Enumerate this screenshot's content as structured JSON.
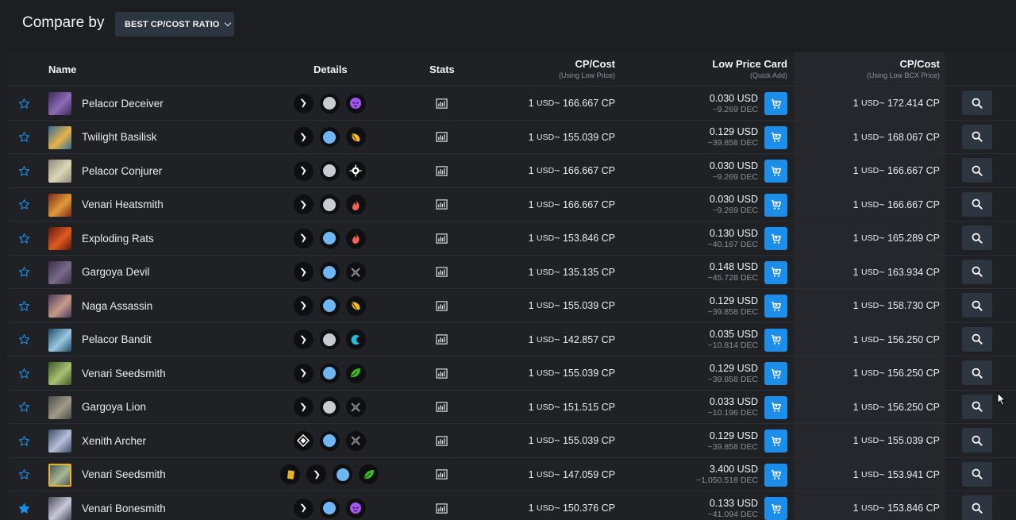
{
  "toolbar": {
    "compare_label": "Compare by",
    "compare_value": "BEST CP/COST RATIO"
  },
  "columns": {
    "name": "Name",
    "details": "Details",
    "stats": "Stats",
    "cp_cost": "CP/Cost",
    "cp_cost_sub": "(Using Low Price)",
    "low_price": "Low Price Card",
    "low_price_sub": "(Quick Add)",
    "cp_cost_bcx": "CP/Cost",
    "cp_cost_bcx_sub": "(Using Low BCX Price)"
  },
  "icons": {
    "favorite": "star-icon",
    "stats": "stats-chart-icon",
    "cart": "cart-icon",
    "inspect": "magnifier-icon"
  },
  "colors": {
    "accent_blue": "#1c8eea",
    "edition_grey": "#c7ccd2",
    "edition_blue": "#6fb6f5",
    "death": "#a855f7",
    "earth": "#3dbb25",
    "fire": "#f0634e",
    "water": "#1fc0df",
    "life": "#f5c013",
    "gold_foil": "#e6b422"
  },
  "rows": [
    {
      "name": "Pelacor Deceiver",
      "thumb": [
        "#3a2a55",
        "#8d6bb8"
      ],
      "fav": false,
      "gold": false,
      "details": [
        "type-monster",
        "edition-grey",
        "death"
      ],
      "cp_ratio": "1 USD ~ 166.667 CP",
      "usd": "0.030 USD",
      "dec": "~9.269 DEC",
      "bcx_ratio": "1 USD ~ 172.414 CP"
    },
    {
      "name": "Twilight Basilisk",
      "thumb": [
        "#2f6c9a",
        "#e8b34a"
      ],
      "fav": false,
      "gold": false,
      "details": [
        "type-monster",
        "edition-blue",
        "life"
      ],
      "cp_ratio": "1 USD ~ 155.039 CP",
      "usd": "0.129 USD",
      "dec": "~39.858 DEC",
      "bcx_ratio": "1 USD ~ 168.067 CP"
    },
    {
      "name": "Pelacor Conjurer",
      "thumb": [
        "#8d8a7a",
        "#ddd6b8"
      ],
      "fav": false,
      "gold": false,
      "details": [
        "type-monster",
        "edition-grey",
        "neutral"
      ],
      "cp_ratio": "1 USD ~ 166.667 CP",
      "usd": "0.030 USD",
      "dec": "~9.269 DEC",
      "bcx_ratio": "1 USD ~ 166.667 CP"
    },
    {
      "name": "Venari Heatsmith",
      "thumb": [
        "#7a2a1a",
        "#e09a3a"
      ],
      "fav": false,
      "gold": false,
      "details": [
        "type-monster",
        "edition-grey",
        "fire"
      ],
      "cp_ratio": "1 USD ~ 166.667 CP",
      "usd": "0.030 USD",
      "dec": "~9.269 DEC",
      "bcx_ratio": "1 USD ~ 166.667 CP"
    },
    {
      "name": "Exploding Rats",
      "thumb": [
        "#5a1a10",
        "#e05a20"
      ],
      "fav": false,
      "gold": false,
      "details": [
        "type-monster",
        "edition-blue",
        "fire"
      ],
      "cp_ratio": "1 USD ~ 153.846 CP",
      "usd": "0.130 USD",
      "dec": "~40.167 DEC",
      "bcx_ratio": "1 USD ~ 165.289 CP"
    },
    {
      "name": "Gargoya Devil",
      "thumb": [
        "#3a3045",
        "#7a6a8a"
      ],
      "fav": false,
      "gold": false,
      "details": [
        "type-monster",
        "edition-blue",
        "dragon"
      ],
      "cp_ratio": "1 USD ~ 135.135 CP",
      "usd": "0.148 USD",
      "dec": "~45.728 DEC",
      "bcx_ratio": "1 USD ~ 163.934 CP"
    },
    {
      "name": "Naga Assassin",
      "thumb": [
        "#4a3a5a",
        "#c89a8a"
      ],
      "fav": false,
      "gold": false,
      "details": [
        "type-monster",
        "edition-blue",
        "life"
      ],
      "cp_ratio": "1 USD ~ 155.039 CP",
      "usd": "0.129 USD",
      "dec": "~39.858 DEC",
      "bcx_ratio": "1 USD ~ 158.730 CP"
    },
    {
      "name": "Pelacor Bandit",
      "thumb": [
        "#1f4a6a",
        "#9ac8e0"
      ],
      "fav": false,
      "gold": false,
      "details": [
        "type-monster",
        "edition-grey",
        "water"
      ],
      "cp_ratio": "1 USD ~ 142.857 CP",
      "usd": "0.035 USD",
      "dec": "~10.814 DEC",
      "bcx_ratio": "1 USD ~ 156.250 CP"
    },
    {
      "name": "Venari Seedsmith",
      "thumb": [
        "#3a5a2a",
        "#a8c070"
      ],
      "fav": false,
      "gold": false,
      "details": [
        "type-monster",
        "edition-blue",
        "earth"
      ],
      "cp_ratio": "1 USD ~ 155.039 CP",
      "usd": "0.129 USD",
      "dec": "~39.858 DEC",
      "bcx_ratio": "1 USD ~ 156.250 CP"
    },
    {
      "name": "Gargoya Lion",
      "thumb": [
        "#4a4a45",
        "#a09a8a"
      ],
      "fav": false,
      "gold": false,
      "details": [
        "type-monster",
        "edition-grey",
        "dragon"
      ],
      "cp_ratio": "1 USD ~ 151.515 CP",
      "usd": "0.033 USD",
      "dec": "~10.196 DEC",
      "bcx_ratio": "1 USD ~ 156.250 CP"
    },
    {
      "name": "Xenith Archer",
      "thumb": [
        "#3a4a6a",
        "#b8c0d8"
      ],
      "fav": false,
      "gold": false,
      "details": [
        "type-summoner",
        "edition-blue",
        "dragon"
      ],
      "cp_ratio": "1 USD ~ 155.039 CP",
      "usd": "0.129 USD",
      "dec": "~39.858 DEC",
      "bcx_ratio": "1 USD ~ 155.039 CP"
    },
    {
      "name": "Venari Seedsmith",
      "thumb": [
        "#3a4a5a",
        "#a8b890"
      ],
      "fav": false,
      "gold": true,
      "details": [
        "gold-foil",
        "type-monster",
        "edition-blue",
        "earth"
      ],
      "cp_ratio": "1 USD ~ 147.059 CP",
      "usd": "3.400 USD",
      "dec": "~1,050.518 DEC",
      "bcx_ratio": "1 USD ~ 153.941 CP"
    },
    {
      "name": "Venari Bonesmith",
      "thumb": [
        "#4a4a5a",
        "#c8c8d8"
      ],
      "fav": true,
      "gold": false,
      "details": [
        "type-monster",
        "edition-blue",
        "death"
      ],
      "cp_ratio": "1 USD ~ 150.376 CP",
      "usd": "0.133 USD",
      "dec": "~41.094 DEC",
      "bcx_ratio": "1 USD ~ 153.846 CP"
    }
  ]
}
